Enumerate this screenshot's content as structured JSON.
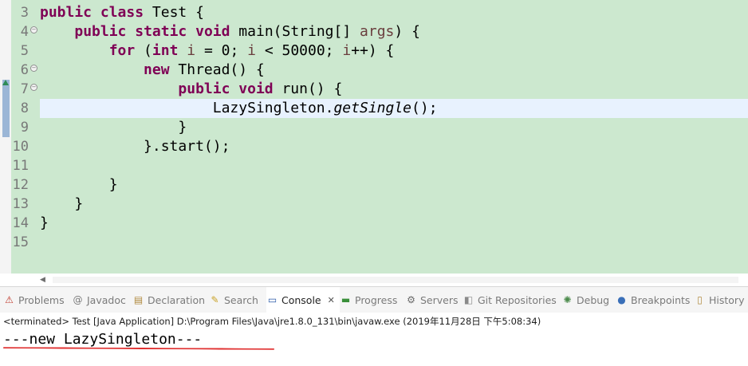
{
  "editor": {
    "lines": [
      {
        "num": "3",
        "fold": false,
        "code": "public class Test {"
      },
      {
        "num": "4",
        "fold": true,
        "code": "    public static void main(String[] args) {"
      },
      {
        "num": "5",
        "fold": false,
        "code": "        for (int i = 0; i < 50000; i++) {"
      },
      {
        "num": "6",
        "fold": true,
        "code": "            new Thread() {"
      },
      {
        "num": "7",
        "fold": true,
        "code": "                public void run() {"
      },
      {
        "num": "8",
        "fold": false,
        "code": "                    LazySingleton.getSingle();"
      },
      {
        "num": "9",
        "fold": false,
        "code": "                }"
      },
      {
        "num": "10",
        "fold": false,
        "code": "            }.start();"
      },
      {
        "num": "11",
        "fold": false,
        "code": ""
      },
      {
        "num": "12",
        "fold": false,
        "code": "        }"
      },
      {
        "num": "13",
        "fold": false,
        "code": "    }"
      },
      {
        "num": "14",
        "fold": false,
        "code": "}"
      },
      {
        "num": "15",
        "fold": false,
        "code": ""
      }
    ],
    "current_line": "8"
  },
  "tabs": [
    {
      "label": "Problems",
      "icon": "problems-icon",
      "glyph": "⚠",
      "color": "#c0392b"
    },
    {
      "label": "Javadoc",
      "icon": "javadoc-icon",
      "glyph": "@",
      "color": "#7a7a7a"
    },
    {
      "label": "Declaration",
      "icon": "declaration-icon",
      "glyph": "▤",
      "color": "#b08a3e"
    },
    {
      "label": "Search",
      "icon": "search-icon",
      "glyph": "✎",
      "color": "#c9a227"
    },
    {
      "label": "Console",
      "icon": "console-icon",
      "glyph": "▭",
      "color": "#2a5aa8",
      "active": true
    },
    {
      "label": "Progress",
      "icon": "progress-icon",
      "glyph": "▬",
      "color": "#3a8f3a"
    },
    {
      "label": "Servers",
      "icon": "servers-icon",
      "glyph": "⚙",
      "color": "#6a6a6a"
    },
    {
      "label": "Git Repositories",
      "icon": "git-icon",
      "glyph": "◧",
      "color": "#8a8a8a"
    },
    {
      "label": "Debug",
      "icon": "debug-icon",
      "glyph": "✺",
      "color": "#4a8a4a"
    },
    {
      "label": "Breakpoints",
      "icon": "breakpoints-icon",
      "glyph": "●",
      "color": "#3a6fb8"
    },
    {
      "label": "History",
      "icon": "history-icon",
      "glyph": "▯",
      "color": "#b08a3e"
    }
  ],
  "console": {
    "close_glyph": "✕",
    "header": "<terminated> Test [Java Application] D:\\Program Files\\Java\\jre1.8.0_131\\bin\\javaw.exe (2019年11月28日 下午5:08:34)",
    "output": "---new LazySingleton---"
  },
  "colors": {
    "editor_bg": "#cce8cf",
    "keyword": "#7f0055",
    "variable": "#6a3e3e",
    "annotation": "#e03030"
  }
}
